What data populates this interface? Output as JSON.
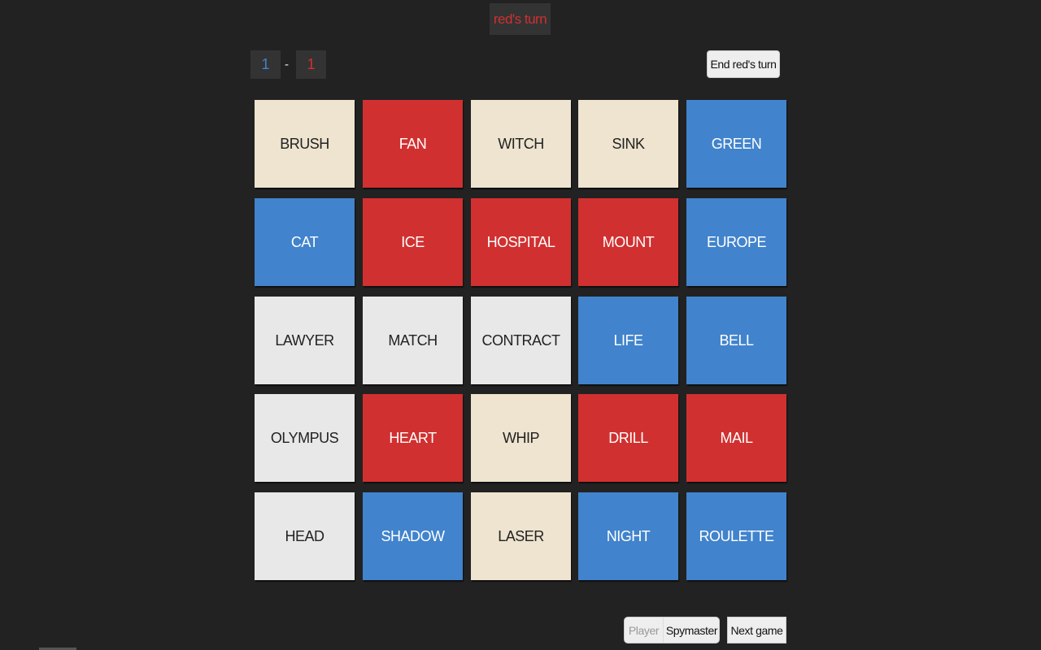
{
  "header": {
    "turn_text": "red's turn"
  },
  "score": {
    "blue": "1",
    "separator": "-",
    "red": "1"
  },
  "controls": {
    "end_turn_label": "End red's turn",
    "role_options": [
      "Player",
      "Spymaster"
    ],
    "selected_role": "Spymaster",
    "next_game_label": "Next game"
  },
  "colors": {
    "red": "#d13030",
    "blue": "#4183cc",
    "neutral": "#e8e8e8",
    "bystander": "#eee4cf",
    "background": "#222222"
  },
  "board": {
    "columns": 5,
    "cards": [
      {
        "word": "BRUSH",
        "team": "bystander"
      },
      {
        "word": "FAN",
        "team": "red"
      },
      {
        "word": "WITCH",
        "team": "bystander"
      },
      {
        "word": "SINK",
        "team": "bystander"
      },
      {
        "word": "GREEN",
        "team": "blue"
      },
      {
        "word": "CAT",
        "team": "blue"
      },
      {
        "word": "ICE",
        "team": "red"
      },
      {
        "word": "HOSPITAL",
        "team": "red"
      },
      {
        "word": "MOUNT",
        "team": "red"
      },
      {
        "word": "EUROPE",
        "team": "blue"
      },
      {
        "word": "LAWYER",
        "team": "neutral"
      },
      {
        "word": "MATCH",
        "team": "neutral"
      },
      {
        "word": "CONTRACT",
        "team": "neutral"
      },
      {
        "word": "LIFE",
        "team": "blue"
      },
      {
        "word": "BELL",
        "team": "blue"
      },
      {
        "word": "OLYMPUS",
        "team": "neutral"
      },
      {
        "word": "HEART",
        "team": "red"
      },
      {
        "word": "WHIP",
        "team": "bystander"
      },
      {
        "word": "DRILL",
        "team": "red"
      },
      {
        "word": "MAIL",
        "team": "red"
      },
      {
        "word": "HEAD",
        "team": "neutral"
      },
      {
        "word": "SHADOW",
        "team": "blue"
      },
      {
        "word": "LASER",
        "team": "bystander"
      },
      {
        "word": "NIGHT",
        "team": "blue"
      },
      {
        "word": "ROULETTE",
        "team": "blue"
      }
    ]
  }
}
